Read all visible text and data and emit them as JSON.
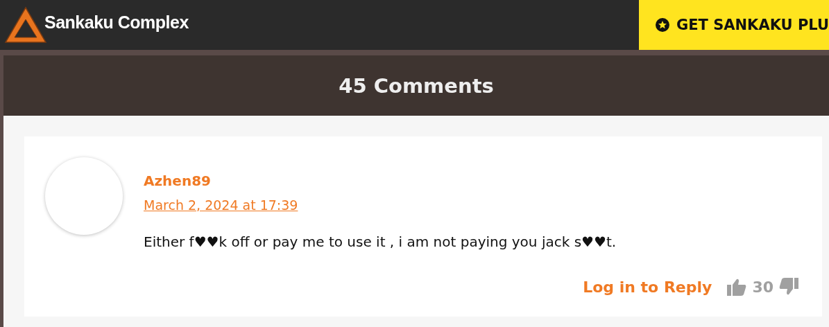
{
  "header": {
    "logo_text": "Sankaku Complex",
    "cta_button": "GET SANKAKU PLU"
  },
  "comments": {
    "title": "45 Comments",
    "items": [
      {
        "author": "Azhen89",
        "date": "March 2, 2024 at 17:39",
        "text": "Either f♥♥k off or pay me to use it , i am not paying you jack s♥♥t.",
        "reply_link": "Log in to Reply",
        "votes": "30"
      }
    ]
  }
}
